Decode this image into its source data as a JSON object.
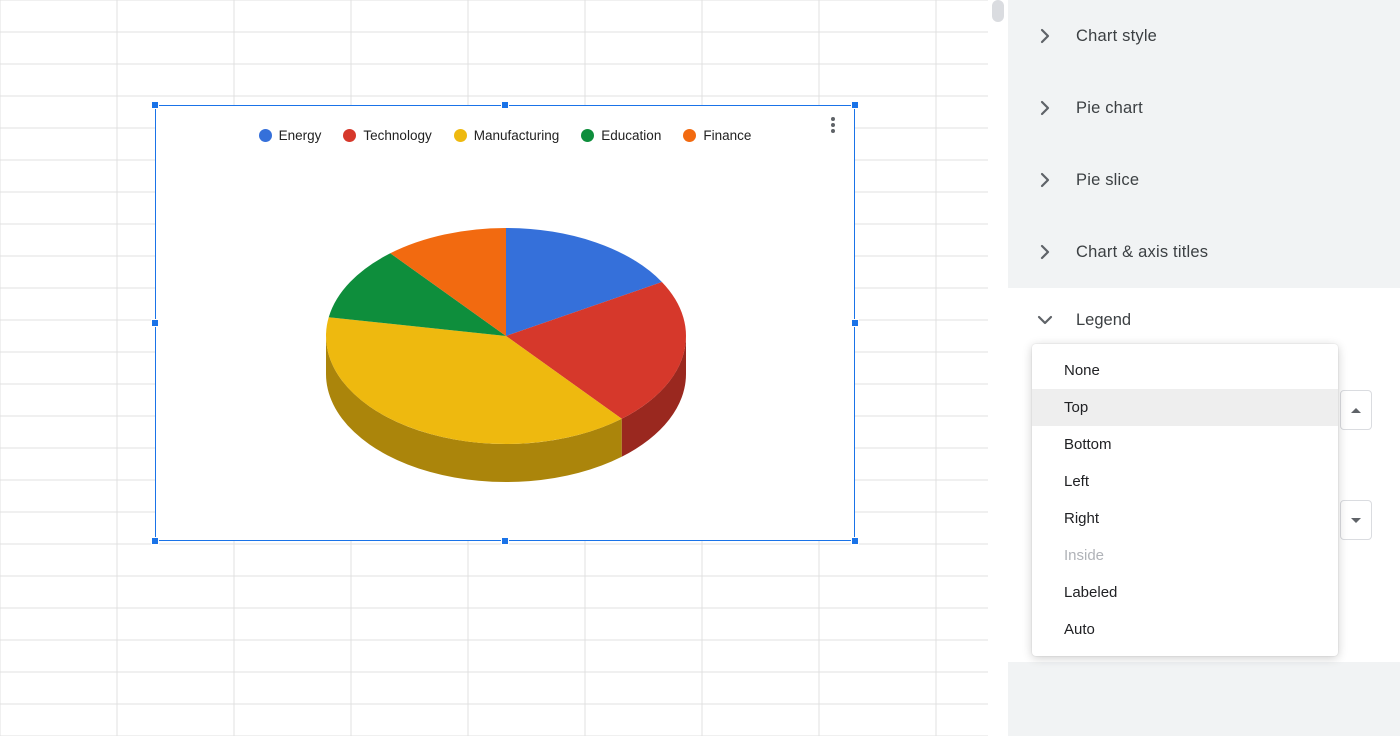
{
  "chart_data": {
    "type": "pie",
    "legend_position": "Top",
    "series": [
      {
        "name": "Energy",
        "value": 15,
        "color": "#3570da"
      },
      {
        "name": "Technology",
        "value": 20,
        "color": "#d6382b"
      },
      {
        "name": "Manufacturing",
        "value": 35,
        "color": "#eeb90f"
      },
      {
        "name": "Education",
        "value": 10,
        "color": "#0e8e3c"
      },
      {
        "name": "Finance",
        "value": 10,
        "color": "#f26a10"
      }
    ]
  },
  "sidebar": {
    "sections": {
      "chart_style": "Chart style",
      "pie_chart": "Pie chart",
      "pie_slice": "Pie slice",
      "chart_axis_titles": "Chart & axis titles",
      "legend": "Legend"
    },
    "legend_position_options": [
      {
        "label": "None",
        "state": ""
      },
      {
        "label": "Top",
        "state": "selected"
      },
      {
        "label": "Bottom",
        "state": ""
      },
      {
        "label": "Left",
        "state": ""
      },
      {
        "label": "Right",
        "state": ""
      },
      {
        "label": "Inside",
        "state": "disabled"
      },
      {
        "label": "Labeled",
        "state": ""
      },
      {
        "label": "Auto",
        "state": ""
      }
    ]
  }
}
